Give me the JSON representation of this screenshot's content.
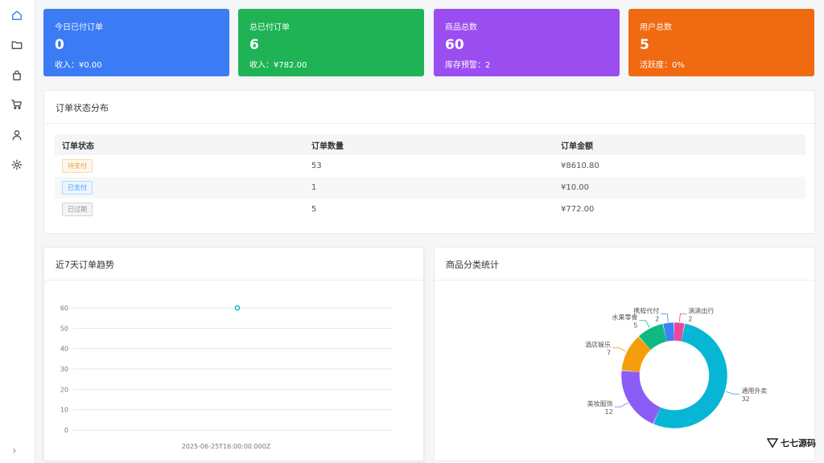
{
  "stats": [
    {
      "title": "今日已付订单",
      "value": "0",
      "sub": "收入：¥0.00",
      "color": "#3b7cf5"
    },
    {
      "title": "总已付订单",
      "value": "6",
      "sub": "收入：¥782.00",
      "color": "#1fb356"
    },
    {
      "title": "商品总数",
      "value": "60",
      "sub": "库存预警：2",
      "color": "#9b4ef0"
    },
    {
      "title": "用户总数",
      "value": "5",
      "sub": "活跃度：0%",
      "color": "#f06a12"
    }
  ],
  "order_status": {
    "title": "订单状态分布",
    "headers": [
      "订单状态",
      "订单数量",
      "订单金额"
    ],
    "rows": [
      {
        "status": "待支付",
        "count": "53",
        "amount": "¥8610.80"
      },
      {
        "status": "已支付",
        "count": "1",
        "amount": "¥10.00"
      },
      {
        "status": "已过期",
        "count": "5",
        "amount": "¥772.00"
      }
    ]
  },
  "trend": {
    "title": "近7天订单趋势",
    "chart_data": {
      "type": "line",
      "x": [
        "2025-06-25T16:00:00.000Z"
      ],
      "series": [
        {
          "values": [
            60
          ]
        }
      ],
      "yticks": [
        "0",
        "10",
        "20",
        "30",
        "40",
        "50",
        "60"
      ],
      "ytick_display": [
        "0",
        "10",
        "20",
        "30",
        "40",
        "50",
        "60"
      ],
      "ylim": [
        0,
        60
      ],
      "xlabel": "",
      "ylabel": ""
    }
  },
  "category": {
    "title": "商品分类统计",
    "chart_data": {
      "type": "pie",
      "slices": [
        {
          "name": "通用外卖",
          "value": 32,
          "color": "#06b6d4"
        },
        {
          "name": "美妆服饰",
          "value": 12,
          "color": "#8b5cf6"
        },
        {
          "name": "酒店娱乐",
          "value": 7,
          "color": "#f59e0b"
        },
        {
          "name": "水果零食",
          "value": 5,
          "color": "#10b981"
        },
        {
          "name": "携程代付",
          "value": 2,
          "color": "#3b82f6"
        },
        {
          "name": "滴滴出行",
          "value": 2,
          "color": "#ec4899"
        }
      ]
    }
  },
  "watermark": {
    "text": "七七源码"
  },
  "icons": [
    "home-icon",
    "folder-icon",
    "bag-icon",
    "cart-icon",
    "user-icon",
    "settings-icon",
    "chevron-right-icon"
  ]
}
